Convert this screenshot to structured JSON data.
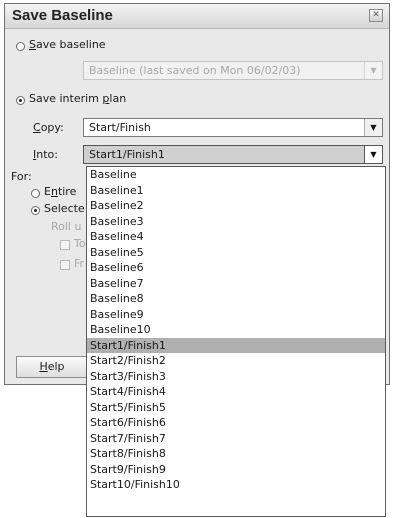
{
  "dialog": {
    "title": "Save Baseline",
    "close_glyph": "✕"
  },
  "save_baseline": {
    "label_u": "S",
    "label_rest": "ave baseline",
    "selected": false,
    "field_value": "Baseline (last saved on Mon 06/02/03)"
  },
  "save_interim": {
    "label_pre": "Save interim ",
    "label_u": "p",
    "label_rest": "lan",
    "selected": true
  },
  "copy": {
    "label_u": "C",
    "label_rest": "opy:",
    "value": "Start/Finish"
  },
  "into": {
    "label_u": "I",
    "label_rest": "nto:",
    "value": "Start1/Finish1"
  },
  "for_section": {
    "label": "For:",
    "entire_u": "n",
    "entire_pre": "E",
    "entire_rest": "tire",
    "selected_tasks": "Selecte",
    "rollup": "Roll u",
    "to_all": "To",
    "from_sub": "Fr"
  },
  "buttons": {
    "help_u": "H",
    "help_rest": "elp"
  },
  "dropdown": {
    "selected": "Start1/Finish1",
    "items": [
      "Baseline",
      "Baseline1",
      "Baseline2",
      "Baseline3",
      "Baseline4",
      "Baseline5",
      "Baseline6",
      "Baseline7",
      "Baseline8",
      "Baseline9",
      "Baseline10",
      "Start1/Finish1",
      "Start2/Finish2",
      "Start3/Finish3",
      "Start4/Finish4",
      "Start5/Finish5",
      "Start6/Finish6",
      "Start7/Finish7",
      "Start8/Finish8",
      "Start9/Finish9",
      "Start10/Finish10"
    ]
  }
}
